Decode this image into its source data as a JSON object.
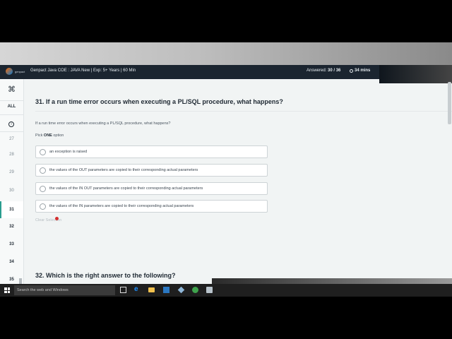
{
  "header": {
    "logo_text": "genpact",
    "test_title": "Genpact Java COE : JAVA New | Exp: 5+ Years | 60 Min",
    "answered_label": "Answered:",
    "answered_value": "30 / 36",
    "timer": "34 mins"
  },
  "sidebar": {
    "all_label": "ALL",
    "questions": [
      {
        "num": "27",
        "state": "answered"
      },
      {
        "num": "28",
        "state": "answered"
      },
      {
        "num": "29",
        "state": "answered"
      },
      {
        "num": "30",
        "state": "answered"
      },
      {
        "num": "31",
        "state": "current"
      },
      {
        "num": "32",
        "state": "unanswered"
      },
      {
        "num": "33",
        "state": "unanswered"
      },
      {
        "num": "34",
        "state": "unanswered"
      },
      {
        "num": "35",
        "state": "unanswered"
      }
    ]
  },
  "question": {
    "title": "31. If a run time error occurs when executing a PL/SQL procedure, what happens?",
    "text": "If a run time error occurs when executing a PL/SQL procedure, what happens?",
    "pick_prefix": "Pick",
    "pick_bold": "ONE",
    "pick_suffix": "option",
    "options": [
      "an exception is raised",
      "the values of the OUT parameters are copied to their corresponding actual parameters",
      "the values of the IN OUT parameters are copied to their corresponding actual parameters",
      "the values of the IN parameters are copied to their corresponding actual parameters"
    ],
    "clear_label": "Clear Selection"
  },
  "next_question": {
    "title": "32. Which is the right answer to the following?"
  },
  "taskbar": {
    "search_placeholder": "Search the web and Windows"
  },
  "colors": {
    "header_bg": "#1b2530",
    "accent": "#2a9d8f",
    "page_bg": "#f1f4f4"
  },
  "icons": {
    "sidebar_top": "command-icon",
    "sidebar_info": "info-icon",
    "timer": "clock-icon"
  }
}
